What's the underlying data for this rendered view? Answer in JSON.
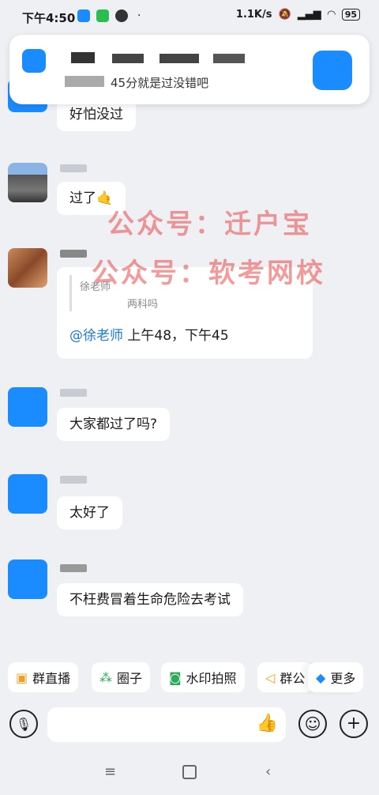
{
  "status_bar": {
    "time": "下午4:50",
    "extra": "·",
    "net_speed": "1.1K/s",
    "battery": "95"
  },
  "notification": {
    "text": "45分就是过没错吧"
  },
  "messages": [
    {
      "text": "好怕没过"
    },
    {
      "text": "过了"
    },
    {
      "quote_name": "徐老师",
      "quote_text": "两科吗",
      "mention": "@徐老师",
      "text": " 上午48，下午45"
    },
    {
      "text": "大家都过了吗?"
    },
    {
      "text": "太好了"
    },
    {
      "text": "不枉费冒着生命危险去考试"
    }
  ],
  "watermarks": [
    "公众号：迁户宝",
    "公众号：软考网校"
  ],
  "quick_actions": [
    {
      "label": "群直播",
      "icon": "live-icon"
    },
    {
      "label": "圈子",
      "icon": "circle-icon"
    },
    {
      "label": "水印拍照",
      "icon": "camera-icon"
    },
    {
      "label": "群公",
      "icon": "announcement-icon"
    },
    {
      "label": "更多",
      "icon": "more-icon"
    }
  ],
  "colors": {
    "accent": "#1a8cff",
    "mention": "#1a7ad6",
    "watermark": "#e84848"
  }
}
